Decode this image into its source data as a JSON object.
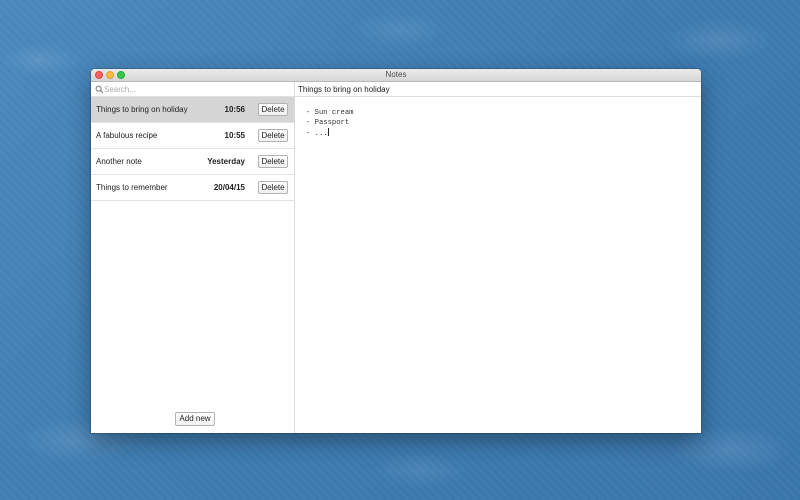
{
  "window": {
    "title": "Notes"
  },
  "search": {
    "placeholder": "Search..."
  },
  "notes": [
    {
      "title": "Things to bring on holiday",
      "time": "10:56",
      "delete_label": "Delete",
      "selected": true
    },
    {
      "title": "A fabulous recipe",
      "time": "10:55",
      "delete_label": "Delete",
      "selected": false
    },
    {
      "title": "Another note",
      "time": "Yesterday",
      "delete_label": "Delete",
      "selected": false
    },
    {
      "title": "Things to remember",
      "time": "20/04/15",
      "delete_label": "Delete",
      "selected": false
    }
  ],
  "sidebar": {
    "add_new_label": "Add new"
  },
  "editor": {
    "title": "Things to bring on holiday",
    "body_lines": [
      "- Sun cream",
      "- Passport",
      "- ..."
    ]
  },
  "colors": {
    "selected_row": "#d5d5d5",
    "close": "#fc605c",
    "minimize": "#fdbc40",
    "zoom": "#34c84a",
    "desktop": "#3f7fb4"
  },
  "icons": {
    "search": "magnifier-icon"
  }
}
